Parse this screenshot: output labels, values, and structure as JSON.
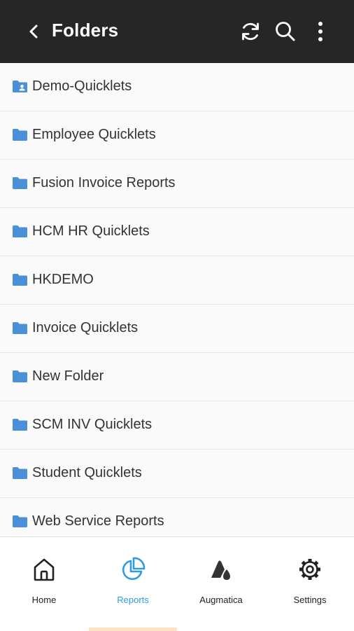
{
  "header": {
    "title": "Folders",
    "icons": [
      "back-icon",
      "refresh-icon",
      "search-icon",
      "more-vert-icon"
    ]
  },
  "folders": [
    {
      "label": "Demo-Quicklets",
      "icon": "shared-folder-icon"
    },
    {
      "label": "Employee Quicklets",
      "icon": "folder-icon"
    },
    {
      "label": "Fusion Invoice Reports",
      "icon": "folder-icon"
    },
    {
      "label": "HCM HR Quicklets",
      "icon": "folder-icon"
    },
    {
      "label": "HKDEMO",
      "icon": "folder-icon"
    },
    {
      "label": "Invoice Quicklets",
      "icon": "folder-icon"
    },
    {
      "label": "New Folder",
      "icon": "folder-icon"
    },
    {
      "label": "SCM INV Quicklets",
      "icon": "folder-icon"
    },
    {
      "label": "Student Quicklets",
      "icon": "folder-icon"
    },
    {
      "label": "Web Service Reports",
      "icon": "folder-icon"
    }
  ],
  "nav": {
    "items": [
      {
        "label": "Home",
        "icon": "home-icon",
        "active": false
      },
      {
        "label": "Reports",
        "icon": "pie-chart-icon",
        "active": true
      },
      {
        "label": "Augmatica",
        "icon": "augmatica-icon",
        "active": false
      },
      {
        "label": "Settings",
        "icon": "gear-icon",
        "active": false
      }
    ]
  },
  "colors": {
    "appbar": "#262626",
    "folder_icon": "#4a90d9",
    "active_tab": "#2f9be0",
    "active_indicator": "#fde3c4"
  }
}
